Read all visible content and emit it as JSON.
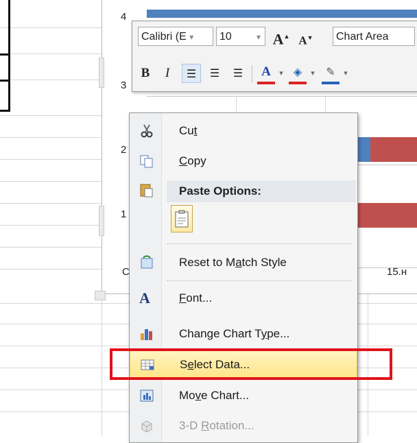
{
  "chart": {
    "y_ticks": [
      "4",
      "3",
      "2",
      "1"
    ],
    "zero_label": "C",
    "x_label": "15.н",
    "series_colors": {
      "blue": "#4f81bd",
      "red": "#c0504d"
    }
  },
  "mini_toolbar": {
    "font_name": "Calibri (E",
    "font_size": "10",
    "grow_font": "A",
    "shrink_font": "A",
    "element_select": "Chart Area",
    "bold": "B",
    "italic": "I",
    "font_color_letter": "A",
    "dropdown_arrow": "▾"
  },
  "context_menu": {
    "items": [
      {
        "label": "Cut",
        "accel": "t",
        "icon": "scissors-icon"
      },
      {
        "label": "Copy",
        "accel": "C",
        "icon": "copy-icon"
      },
      {
        "label": "Paste Options:",
        "icon": "paste-icon"
      },
      {
        "label": "Reset to Match Style",
        "accel": "a",
        "icon": "reset-style-icon"
      },
      {
        "label": "Font...",
        "accel": "F",
        "icon": "font-icon"
      },
      {
        "label": "Change Chart Type...",
        "accel": "y",
        "icon": "chart-type-icon"
      },
      {
        "label": "Select Data...",
        "accel": "e",
        "icon": "select-data-icon"
      },
      {
        "label": "Move Chart...",
        "accel": "v",
        "icon": "move-chart-icon"
      },
      {
        "label": "3-D Rotation...",
        "accel": "R",
        "icon": "rotation-icon",
        "disabled": true
      }
    ]
  },
  "highlight_color": "#e0121a"
}
